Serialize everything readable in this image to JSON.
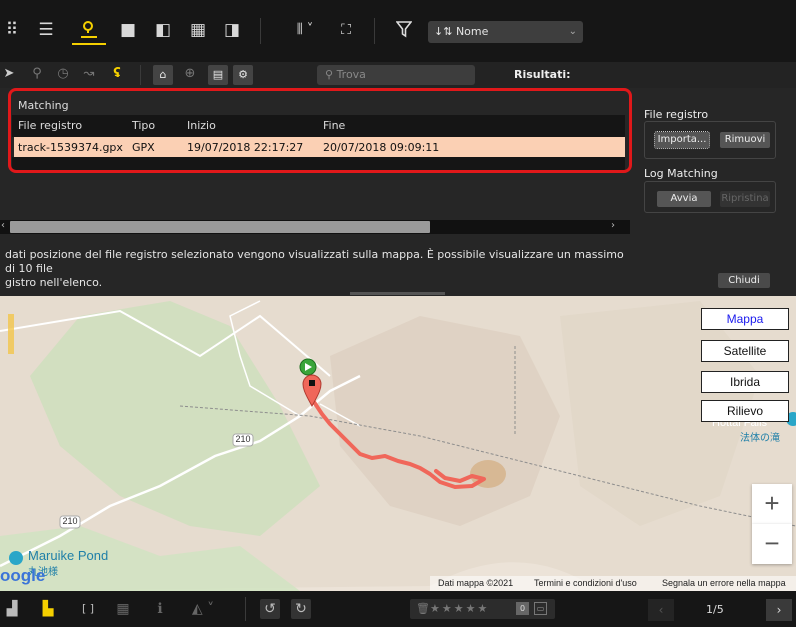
{
  "toolbar": {
    "sort_label": "Nome",
    "icons": [
      "grid-view-icon",
      "list-view-icon",
      "map-view-icon",
      "single-view-icon",
      "compare-view-icon",
      "multi-view-icon",
      "edit-view-icon",
      "panel-layout-icon",
      "fullscreen-icon",
      "filter-icon",
      "sort-icon"
    ]
  },
  "toolbar2": {
    "search_placeholder": "Trova",
    "results_label": "Risultati:"
  },
  "matching": {
    "title": "Matching",
    "columns": [
      "File registro",
      "Tipo",
      "Inizio",
      "Fine"
    ],
    "rows": [
      {
        "file": "track-1539374.gpx",
        "type": "GPX",
        "start": "19/07/2018 22:17:27",
        "end": "20/07/2018 09:09:11"
      }
    ]
  },
  "info_text_line1": "dati posizione del file registro selezionato vengono visualizzati sulla mappa. È possibile visualizzare un massimo di 10 file",
  "info_text_line2": "gistro nell'elenco.",
  "file_registro": {
    "title": "File registro",
    "import_label": "Importa...",
    "remove_label": "Rimuovi"
  },
  "log_matching": {
    "title": "Log Matching",
    "start_label": "Avvia",
    "reset_label": "Ripristina"
  },
  "close_label": "Chiudi",
  "map": {
    "type_buttons": [
      "Mappa",
      "Satellite",
      "Ibrida",
      "Rilievo"
    ],
    "selected_type": "Mappa",
    "road_label_1": "210",
    "road_label_2": "210",
    "poi_label": "Maruike Pond",
    "poi_label_jp": "丸池様",
    "poi_right_label": "Hottai Falls",
    "poi_right_jp": "法体の滝",
    "google_logo": "oogle",
    "zoom_in": "+",
    "zoom_out": "−",
    "footer_data": "Dati mappa ©2021",
    "footer_terms": "Termini e condizioni d'uso",
    "footer_report": "Segnala un errore nella mappa",
    "track_color": "#f0675a",
    "start_marker_color": "#3aa53a",
    "end_marker_color": "#f0675a"
  },
  "bottombar": {
    "page_indicator": "1/5",
    "stars": "★★★★★"
  }
}
